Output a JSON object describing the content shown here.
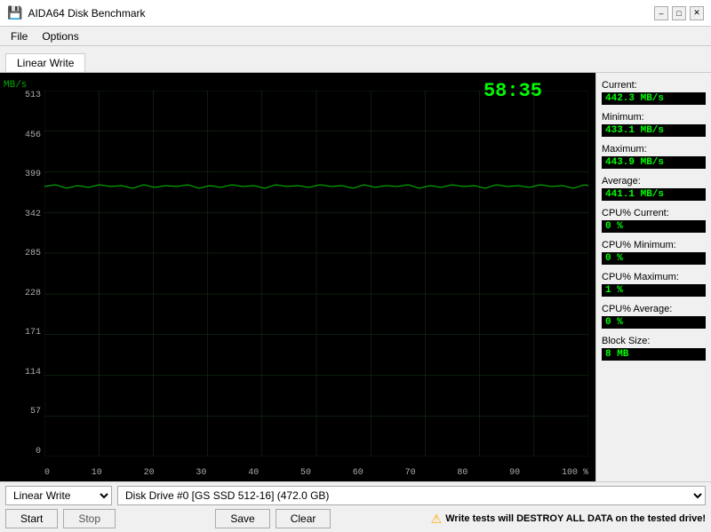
{
  "window": {
    "title": "AIDA64 Disk Benchmark"
  },
  "menu": {
    "items": [
      "File",
      "Options"
    ]
  },
  "tab": {
    "label": "Linear Write"
  },
  "chart": {
    "timer": "58:35",
    "y_label": "MB/s",
    "y_ticks": [
      "513",
      "456",
      "399",
      "342",
      "285",
      "228",
      "171",
      "114",
      "57",
      "0"
    ],
    "x_ticks": [
      "0",
      "10",
      "20",
      "30",
      "40",
      "50",
      "60",
      "70",
      "80",
      "90",
      "100 %"
    ]
  },
  "stats": {
    "current_label": "Current:",
    "current_value": "442.3 MB/s",
    "minimum_label": "Minimum:",
    "minimum_value": "433.1 MB/s",
    "maximum_label": "Maximum:",
    "maximum_value": "443.9 MB/s",
    "average_label": "Average:",
    "average_value": "441.1 MB/s",
    "cpu_current_label": "CPU% Current:",
    "cpu_current_value": "0 %",
    "cpu_minimum_label": "CPU% Minimum:",
    "cpu_minimum_value": "0 %",
    "cpu_maximum_label": "CPU% Maximum:",
    "cpu_maximum_value": "1 %",
    "cpu_average_label": "CPU% Average:",
    "cpu_average_value": "0 %",
    "block_size_label": "Block Size:",
    "block_size_value": "8 MB"
  },
  "controls": {
    "test_options": [
      "Linear Write"
    ],
    "test_selected": "Linear Write",
    "disk_options": [
      "Disk Drive #0  [GS SSD 512-16]  (472.0 GB)"
    ],
    "disk_selected": "Disk Drive #0  [GS SSD 512-16]  (472.0 GB)",
    "start_label": "Start",
    "stop_label": "Stop",
    "save_label": "Save",
    "clear_label": "Clear",
    "warning_text": "Write tests will DESTROY ALL DATA on the tested drive!"
  }
}
